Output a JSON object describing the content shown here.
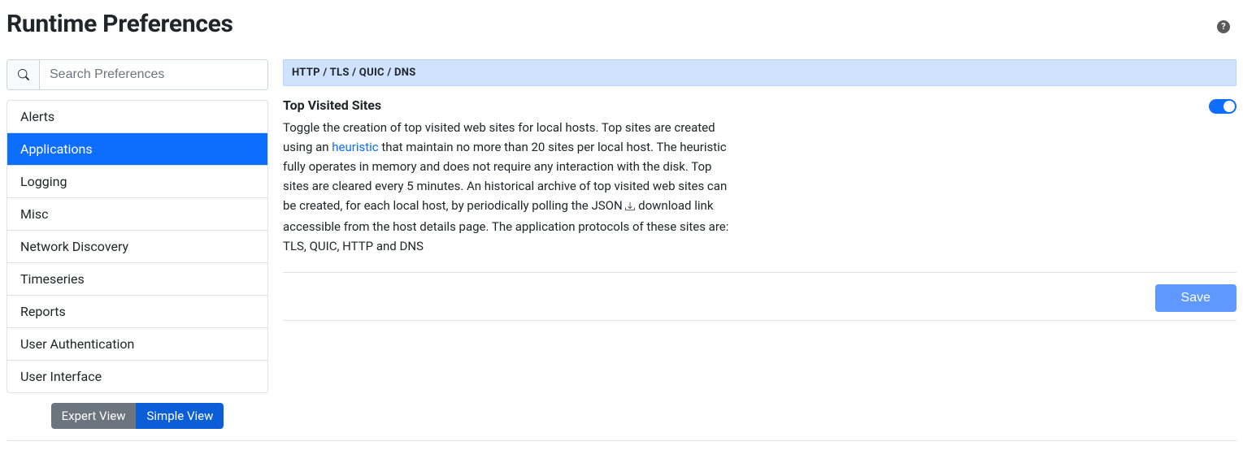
{
  "header": {
    "title": "Runtime Preferences",
    "help_glyph": "?"
  },
  "search": {
    "placeholder": "Search Preferences"
  },
  "sidebar": {
    "items": [
      {
        "label": "Alerts"
      },
      {
        "label": "Applications"
      },
      {
        "label": "Logging"
      },
      {
        "label": "Misc"
      },
      {
        "label": "Network Discovery"
      },
      {
        "label": "Timeseries"
      },
      {
        "label": "Reports"
      },
      {
        "label": "User Authentication"
      },
      {
        "label": "User Interface"
      }
    ],
    "active_index": 1
  },
  "view_toggle": {
    "expert_label": "Expert View",
    "simple_label": "Simple View",
    "active": "simple"
  },
  "section": {
    "header": "HTTP / TLS / QUIC / DNS"
  },
  "setting": {
    "title": "Top Visited Sites",
    "desc_part1": "Toggle the creation of top visited web sites for local hosts. Top sites are created using an ",
    "link_text": "heuristic",
    "desc_part2": " that maintain no more than 20 sites per local host. The heuristic fully operates in memory and does not require any interaction with the disk. Top sites are cleared every 5 minutes. An historical archive of top visited web sites can be created, for each local host, by periodically polling the JSON ",
    "desc_part3": " download link accessible from the host details page. The application protocols of these sites are: TLS, QUIC, HTTP and DNS",
    "enabled": true
  },
  "actions": {
    "save_label": "Save"
  }
}
